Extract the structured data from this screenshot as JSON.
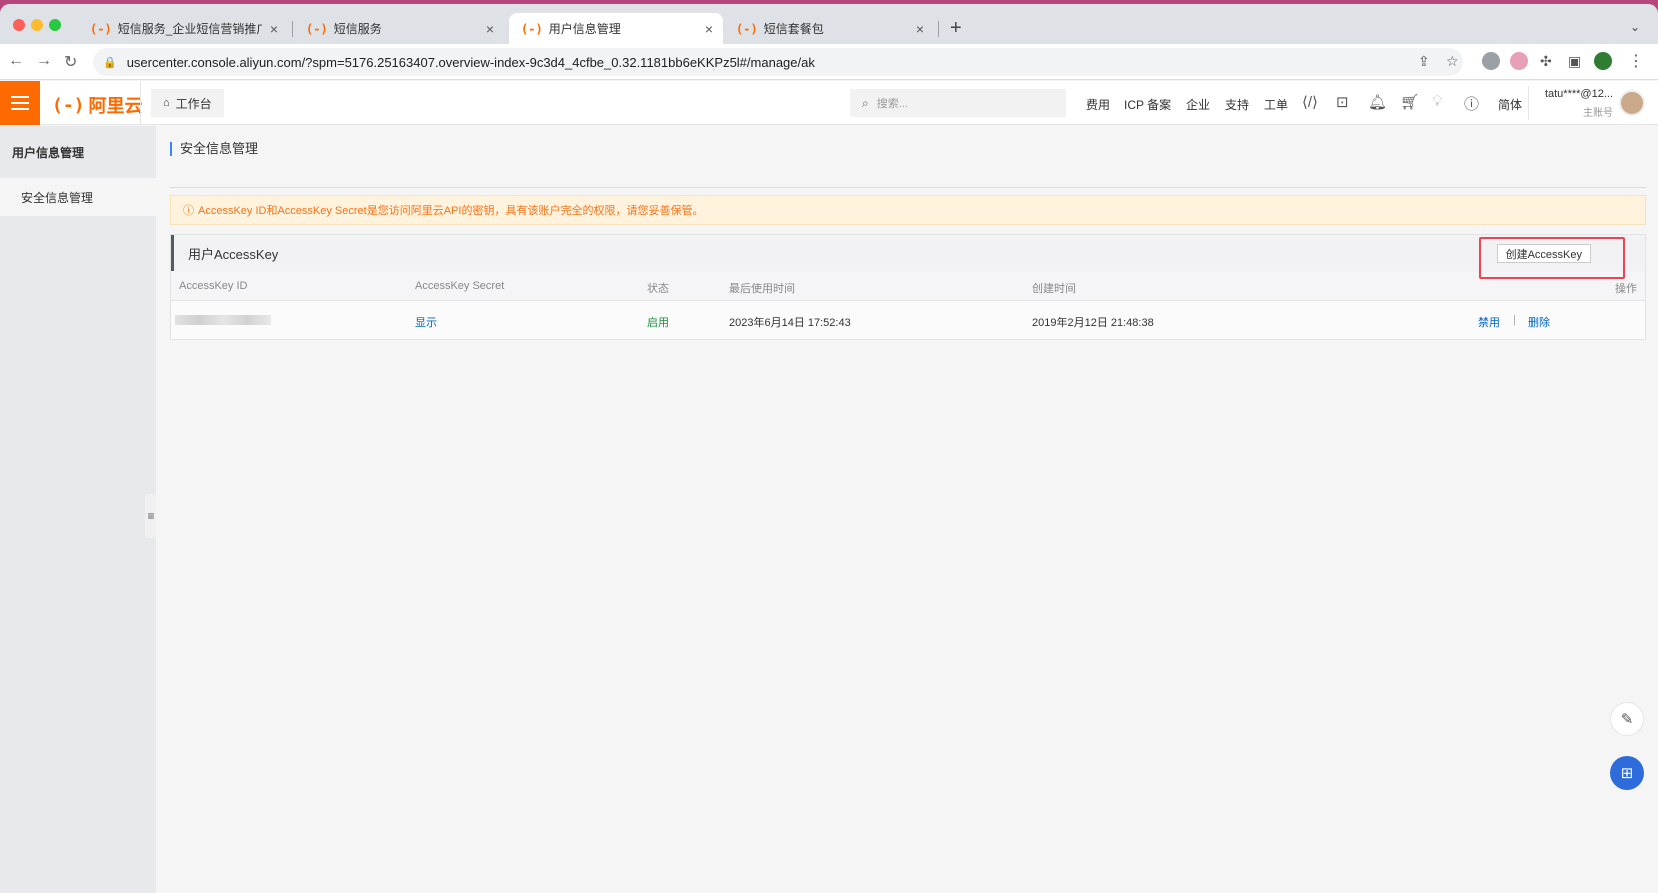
{
  "browser": {
    "tabs": [
      {
        "title": "短信服务_企业短信营销推广_验",
        "active": false
      },
      {
        "title": "短信服务",
        "active": false
      },
      {
        "title": "用户信息管理",
        "active": true
      },
      {
        "title": "短信套餐包",
        "active": false
      }
    ],
    "tab_favicon": "(-)",
    "tab_close": "×",
    "new_tab": "+",
    "tab_menu": "⌄",
    "url": "usercenter.console.aliyun.com/?spm=5176.25163407.overview-index-9c3d4_4cfbe_0.32.1181bb6eKKPz5l#/manage/ak"
  },
  "header": {
    "logo_mark": "(-)",
    "logo_text": "阿里云",
    "workbench": "工作台",
    "search_placeholder": "搜索...",
    "nav": [
      "费用",
      "ICP 备案",
      "企业",
      "支持",
      "工单"
    ],
    "language": "简体",
    "user_name": "tatu****@12...",
    "user_role": "主账号"
  },
  "sidebar": {
    "header": "用户信息管理",
    "items": [
      "安全信息管理"
    ]
  },
  "main": {
    "title": "安全信息管理",
    "alert": "AccessKey ID和AccessKey Secret是您访问阿里云API的密钥，具有该账户完全的权限，请您妥善保管。",
    "panel_title": "用户AccessKey",
    "create_button": "创建AccessKey",
    "columns": [
      "AccessKey ID",
      "AccessKey Secret",
      "状态",
      "最后使用时间",
      "创建时间",
      "操作"
    ],
    "rows": [
      {
        "secret_action": "显示",
        "status": "启用",
        "last_used": "2023年6月14日 17:52:43",
        "created": "2019年2月12日 21:48:38",
        "actions": [
          "禁用",
          "删除"
        ]
      }
    ]
  },
  "colors": {
    "brand": "#ff6a00",
    "link": "#0064c8",
    "status_enabled": "#1e8e3e",
    "highlight": "#ea4455",
    "alert_text": "#f5741a"
  },
  "icons": {
    "home": "home-icon",
    "search": "search-icon",
    "bell": "bell-icon",
    "cart": "cart-icon",
    "help": "help-icon"
  }
}
